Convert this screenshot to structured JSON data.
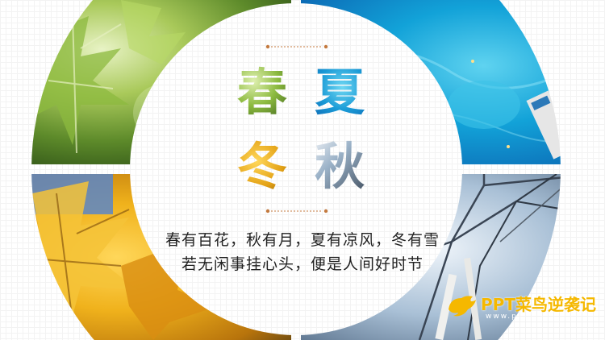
{
  "seasons": {
    "spring": "春",
    "summer": "夏",
    "autumn": "秋",
    "winter": "冬"
  },
  "poem": {
    "line1": "春有百花，秋有月，夏有凉风，冬有雪",
    "line2": "若无闲事挂心头，便是人间好时节"
  },
  "logo": {
    "text": "PPT菜鸟逆袭记",
    "sub": "www.p"
  },
  "colors": {
    "spring": "#6e9a2f",
    "summer": "#1a9ad6",
    "autumn": "#e3a114",
    "winter": "#8aa7c2",
    "logo": "#f5b800"
  }
}
